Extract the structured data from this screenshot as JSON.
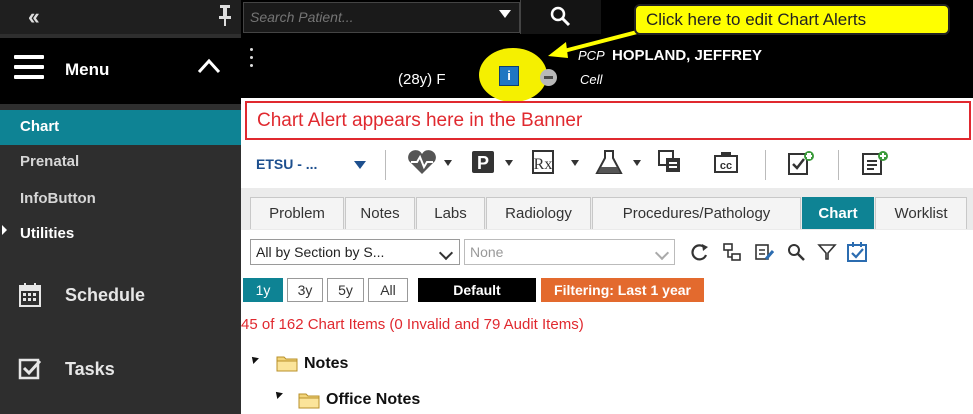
{
  "sidebar": {
    "collapse_icon": "double-chevron-left-icon",
    "pin_icon": "pin-icon",
    "menu_label": "Menu",
    "items": [
      {
        "label": "Chart",
        "active": true
      },
      {
        "label": "Prenatal"
      },
      {
        "label": "InfoButton"
      },
      {
        "label": "Utilities"
      }
    ],
    "big_items": [
      {
        "label": "Schedule",
        "icon": "calendar-icon"
      },
      {
        "label": "Tasks",
        "icon": "checkbox-icon"
      }
    ]
  },
  "search": {
    "placeholder": "Search Patient...",
    "button_icon": "search-icon"
  },
  "banner": {
    "age_sex": "(28y)  F",
    "pcp_prefix": "PCP",
    "pcp_name": "HOPLAND, JEFFREY",
    "cell_label": "Cell",
    "alert_icon": "i"
  },
  "callout": {
    "text": "Click here to edit Chart Alerts"
  },
  "chart_alert": {
    "text": "Chart Alert appears here in the Banner"
  },
  "toolbar": {
    "location": "ETSU - ...",
    "icons": [
      "heart-monitor-icon",
      "p-icon",
      "rx-icon",
      "flask-icon",
      "print-icon",
      "cc-icon",
      "note-check-icon",
      "note-add-icon"
    ]
  },
  "tabs": [
    {
      "label": "Problem"
    },
    {
      "label": "Notes"
    },
    {
      "label": "Labs"
    },
    {
      "label": "Radiology"
    },
    {
      "label": "Procedures/Pathology"
    },
    {
      "label": "Chart",
      "active": true
    },
    {
      "label": "Worklist"
    }
  ],
  "filters": {
    "section_select": "All by Section by S...",
    "secondary_select": "None"
  },
  "range_buttons": [
    "1y",
    "3y",
    "5y",
    "All"
  ],
  "default_label": "Default",
  "filter_badge": "Filtering: Last 1 year",
  "item_count": "45 of 162 Chart Items (0 Invalid and 79 Audit Items)",
  "tree": {
    "root": "Notes",
    "child": "Office Notes"
  },
  "colors": {
    "teal": "#0e8394",
    "alert_red": "#e0292f",
    "callout_yellow": "#ffff00",
    "filter_orange": "#e36a2e"
  }
}
